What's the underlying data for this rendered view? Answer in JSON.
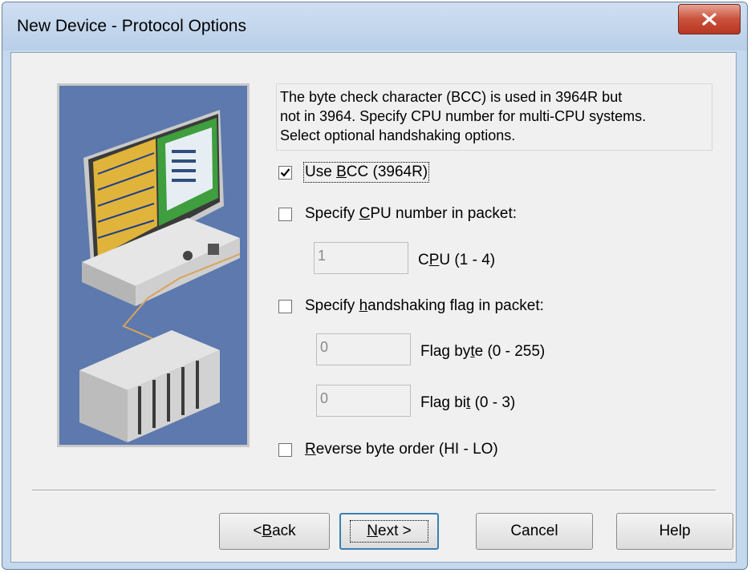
{
  "window": {
    "title": "New Device - Protocol Options"
  },
  "description": {
    "line1": "The byte check character (BCC) is used in 3964R but",
    "line2": "not in 3964.  Specify CPU number for multi-CPU systems.",
    "line3": "Select optional handshaking options."
  },
  "options": {
    "use_bcc": {
      "pre": "Use ",
      "key": "B",
      "post": "CC (3964R)",
      "checked": true
    },
    "cpu_number": {
      "pre": "Specify ",
      "key": "C",
      "post": "PU number in packet:",
      "checked": false
    },
    "handshaking": {
      "pre": "Specify ",
      "key": "h",
      "post": "andshaking flag in packet:",
      "checked": false
    },
    "reverse": {
      "pre": "",
      "key": "R",
      "post": "everse byte order (HI - LO)",
      "checked": false
    }
  },
  "fields": {
    "cpu": {
      "value": "1",
      "label_pre": "C",
      "label_key": "P",
      "label_post": "U (1 - 4)"
    },
    "flag_byte": {
      "value": "0",
      "label_pre": "Flag by",
      "label_key": "t",
      "label_post": "e (0 - 255)"
    },
    "flag_bit": {
      "value": "0",
      "label_pre": "Flag bi",
      "label_key": "t",
      "label_post": " (0 - 3)"
    }
  },
  "buttons": {
    "back": {
      "pre": "< ",
      "key": "B",
      "post": "ack"
    },
    "next": {
      "pre": "",
      "key": "N",
      "post": "ext >"
    },
    "cancel": "Cancel",
    "help": "Help"
  },
  "colors": {
    "title_bar": "#c4d8ee",
    "close": "#c9523c",
    "illustration_bg": "#5d79ad",
    "default_button_border": "#3c7fb1"
  },
  "icons": [
    "close-icon",
    "device-illustration",
    "check-icon"
  ]
}
